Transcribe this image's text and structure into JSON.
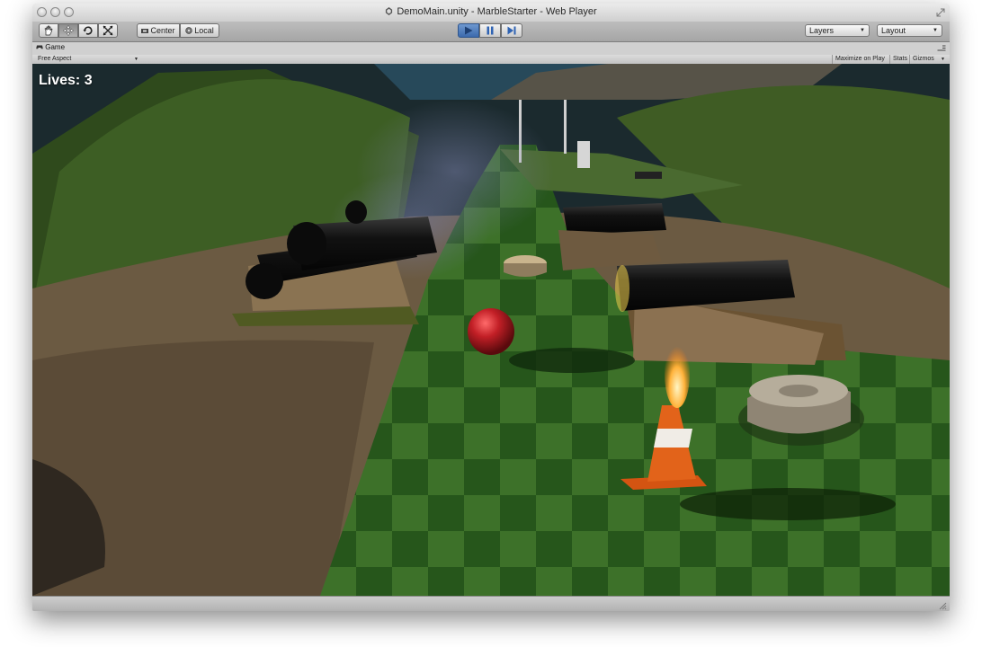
{
  "window": {
    "title": "DemoMain.unity - MarbleStarter - Web Player"
  },
  "toolbar": {
    "hand_tool": "hand-icon",
    "move_tool": "move-icon",
    "rotate_tool": "rotate-icon",
    "scale_tool": "scale-icon",
    "pivot_label": "Center",
    "space_label": "Local",
    "layers_label": "Layers",
    "layout_label": "Layout"
  },
  "game_view": {
    "tab_label": "Game",
    "aspect_label": "Free Aspect",
    "maximize_label": "Maximize on Play",
    "stats_label": "Stats",
    "gizmos_label": "Gizmos"
  },
  "hud": {
    "lives_text": "Lives: 3"
  },
  "colors": {
    "play_accent": "#3c6aad",
    "turf_dark": "#2f6a22",
    "turf_light": "#4b8a33",
    "marble": "#b81c22"
  }
}
